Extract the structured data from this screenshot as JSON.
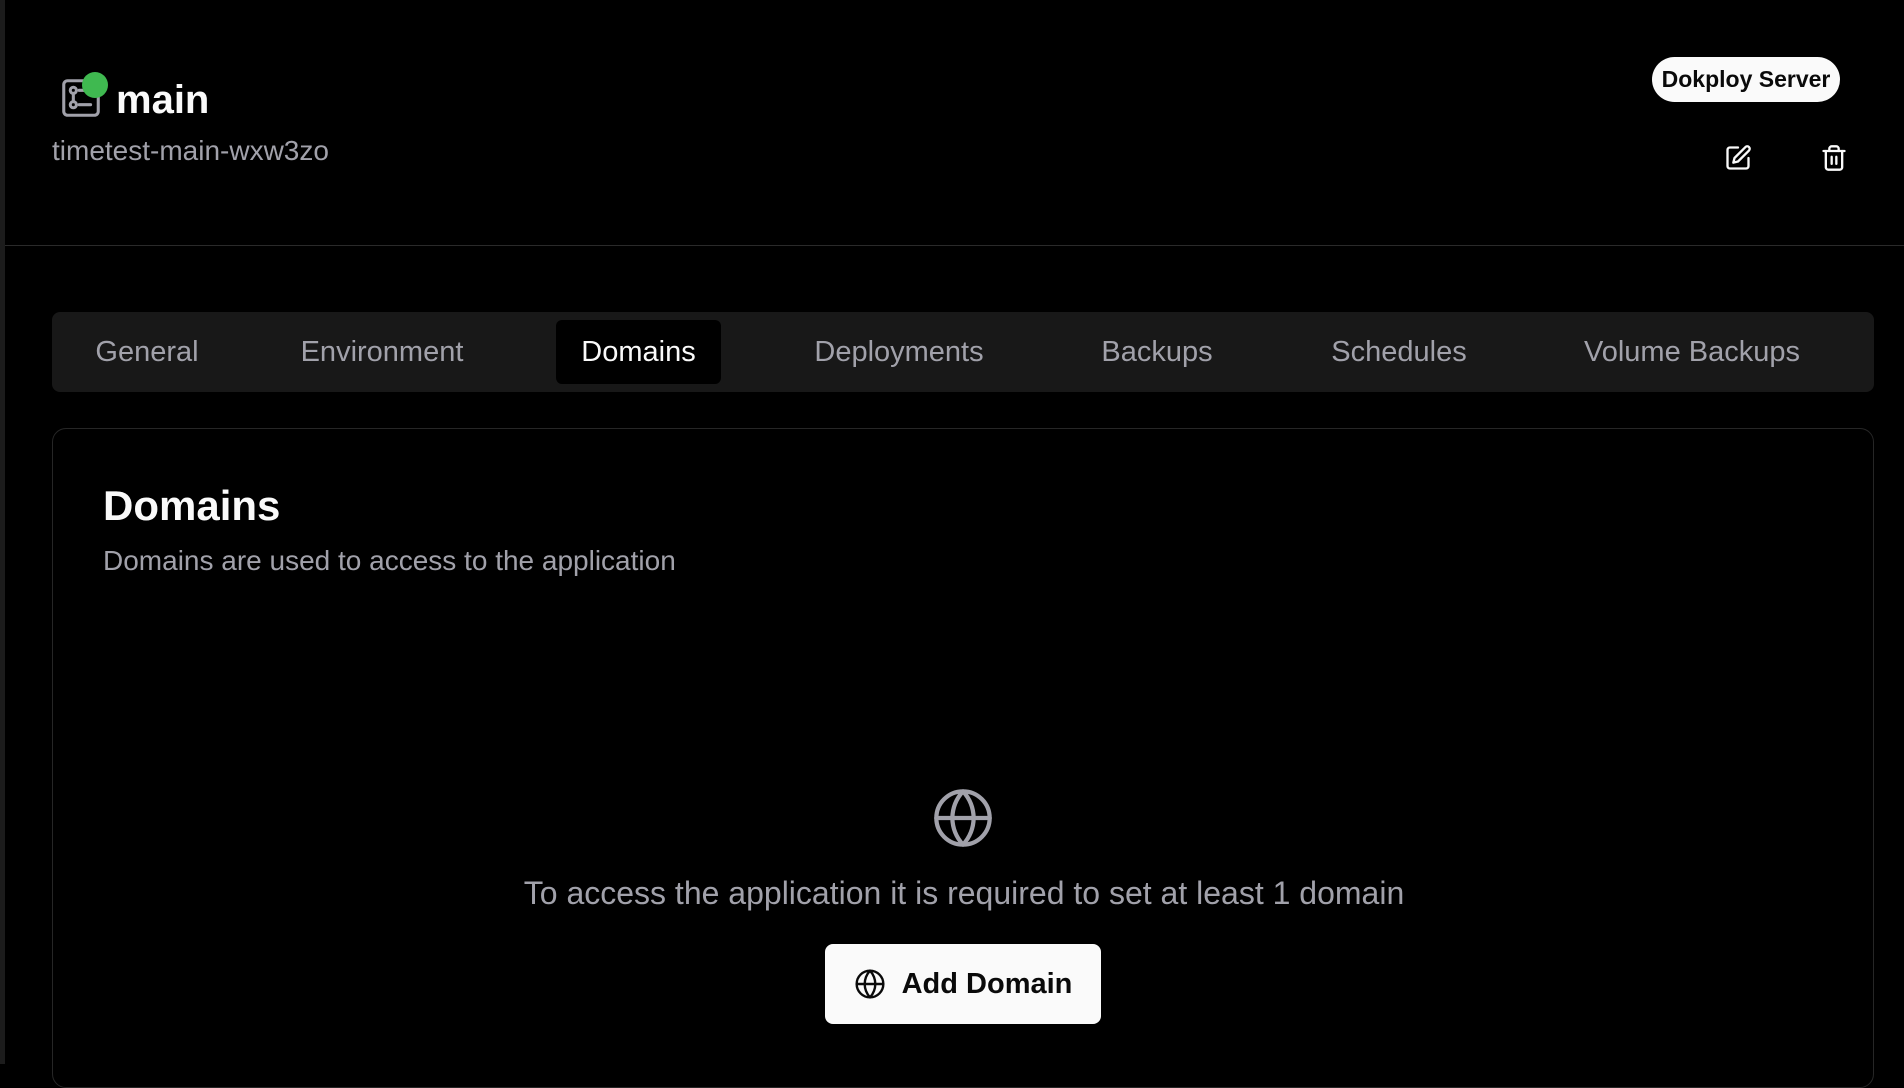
{
  "header": {
    "title": "main",
    "subtitle": "timetest-main-wxw3zo",
    "server_badge": "Dokploy Server",
    "status_color": "#3fb950",
    "icons": [
      "server-icon",
      "edit-icon",
      "trash-icon"
    ]
  },
  "tabs": [
    {
      "label": "General",
      "active": false
    },
    {
      "label": "Environment",
      "active": false
    },
    {
      "label": "Domains",
      "active": true
    },
    {
      "label": "Deployments",
      "active": false
    },
    {
      "label": "Backups",
      "active": false
    },
    {
      "label": "Schedules",
      "active": false
    },
    {
      "label": "Volume Backups",
      "active": false
    }
  ],
  "card": {
    "title": "Domains",
    "description": "Domains are used to access to the application",
    "empty_icon": "globe-icon",
    "empty_message": "To access the application it is required to set at least 1 domain",
    "add_button_label": "Add Domain"
  }
}
